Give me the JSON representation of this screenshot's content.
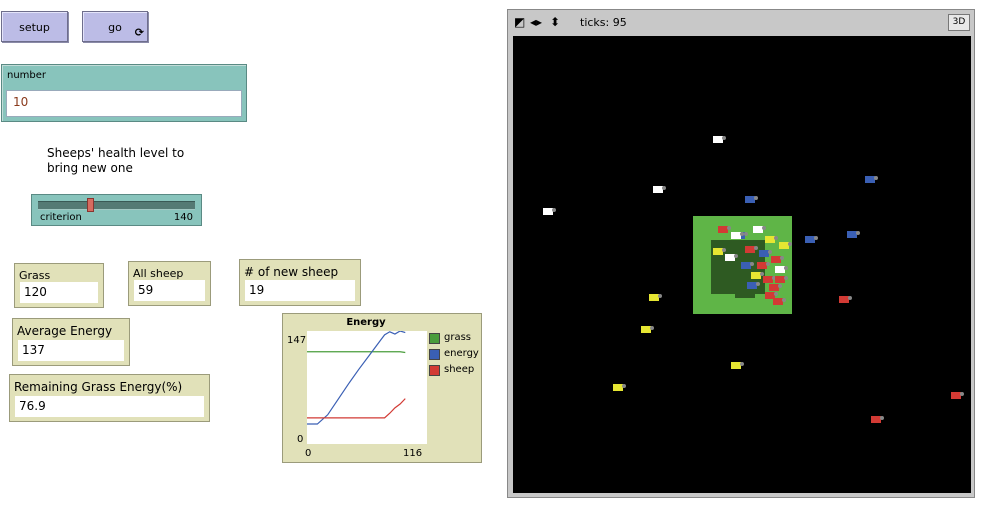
{
  "buttons": {
    "setup": "setup",
    "go": "go",
    "forever_glyph": "⟳"
  },
  "number_input": {
    "title": "number",
    "value": "10"
  },
  "note": {
    "line1": "Sheeps' health level to",
    "line2": "bring new one"
  },
  "slider": {
    "name": "criterion",
    "value": "140",
    "min": 0,
    "max": 1000,
    "fraction": 0.14
  },
  "monitors": {
    "grass": {
      "label": "Grass",
      "value": "120"
    },
    "all_sheep": {
      "label": "All sheep",
      "value": "59"
    },
    "new_sheep": {
      "label": "# of new sheep",
      "value": "19"
    },
    "avg_energy": {
      "label": "Average Energy",
      "value": "137"
    },
    "remaining": {
      "label": "Remaining Grass Energy(%)",
      "value": "76.9"
    }
  },
  "plot": {
    "title": "Energy",
    "y_max_label": "147",
    "y_min_label": "0",
    "x_min_label": "0",
    "x_max_label": "116",
    "legend": [
      {
        "name": "grass",
        "color": "#4a9d3c"
      },
      {
        "name": "energy",
        "color": "#3a5fb4"
      },
      {
        "name": "sheep",
        "color": "#d23a34"
      }
    ]
  },
  "chart_data": {
    "type": "line",
    "title": "Energy",
    "xlim": [
      0,
      116
    ],
    "ylim": [
      0,
      147
    ],
    "series": [
      {
        "name": "grass",
        "color": "#4a9d3c",
        "x": [
          0,
          10,
          20,
          30,
          40,
          50,
          60,
          70,
          80,
          90,
          95
        ],
        "y": [
          120,
          120,
          120,
          120,
          120,
          120,
          120,
          120,
          120,
          120,
          119
        ]
      },
      {
        "name": "energy",
        "color": "#3a5fb4",
        "x": [
          0,
          10,
          20,
          30,
          40,
          50,
          60,
          70,
          75,
          80,
          85,
          90,
          95
        ],
        "y": [
          26,
          26,
          38,
          58,
          78,
          97,
          115,
          133,
          142,
          146,
          143,
          147,
          145
        ]
      },
      {
        "name": "sheep",
        "color": "#d23a34",
        "x": [
          0,
          10,
          20,
          30,
          40,
          50,
          60,
          70,
          75,
          80,
          85,
          90,
          95
        ],
        "y": [
          34,
          34,
          34,
          34,
          34,
          34,
          34,
          34,
          34,
          40,
          47,
          52,
          59
        ]
      }
    ]
  },
  "view": {
    "ticks_label": "ticks: 95",
    "three_d": "3D"
  },
  "colors": {
    "button": "#bcbce6",
    "input": "#88c4bc",
    "monitor": "#e1e1b9",
    "grass": "#5fb547",
    "dark_grass": "#2e5a22"
  }
}
